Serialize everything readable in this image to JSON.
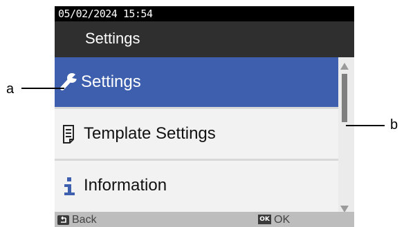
{
  "status_bar": {
    "datetime": "05/02/2024 15:54"
  },
  "header": {
    "title": "Settings"
  },
  "menu": {
    "items": [
      {
        "label": "Settings",
        "icon": "wrench-icon",
        "selected": true
      },
      {
        "label": "Template Settings",
        "icon": "template-icon",
        "selected": false
      },
      {
        "label": "Information",
        "icon": "info-icon",
        "selected": false
      }
    ]
  },
  "softkeys": {
    "back_label": "Back",
    "ok_badge": "OK",
    "ok_label": "OK"
  },
  "callouts": {
    "left": "a",
    "right": "b"
  },
  "colors": {
    "selection": "#3e5fae",
    "title_bar": "#2f2f2f",
    "status_bar": "#000000",
    "bottom_bar": "#bdbdbd"
  }
}
